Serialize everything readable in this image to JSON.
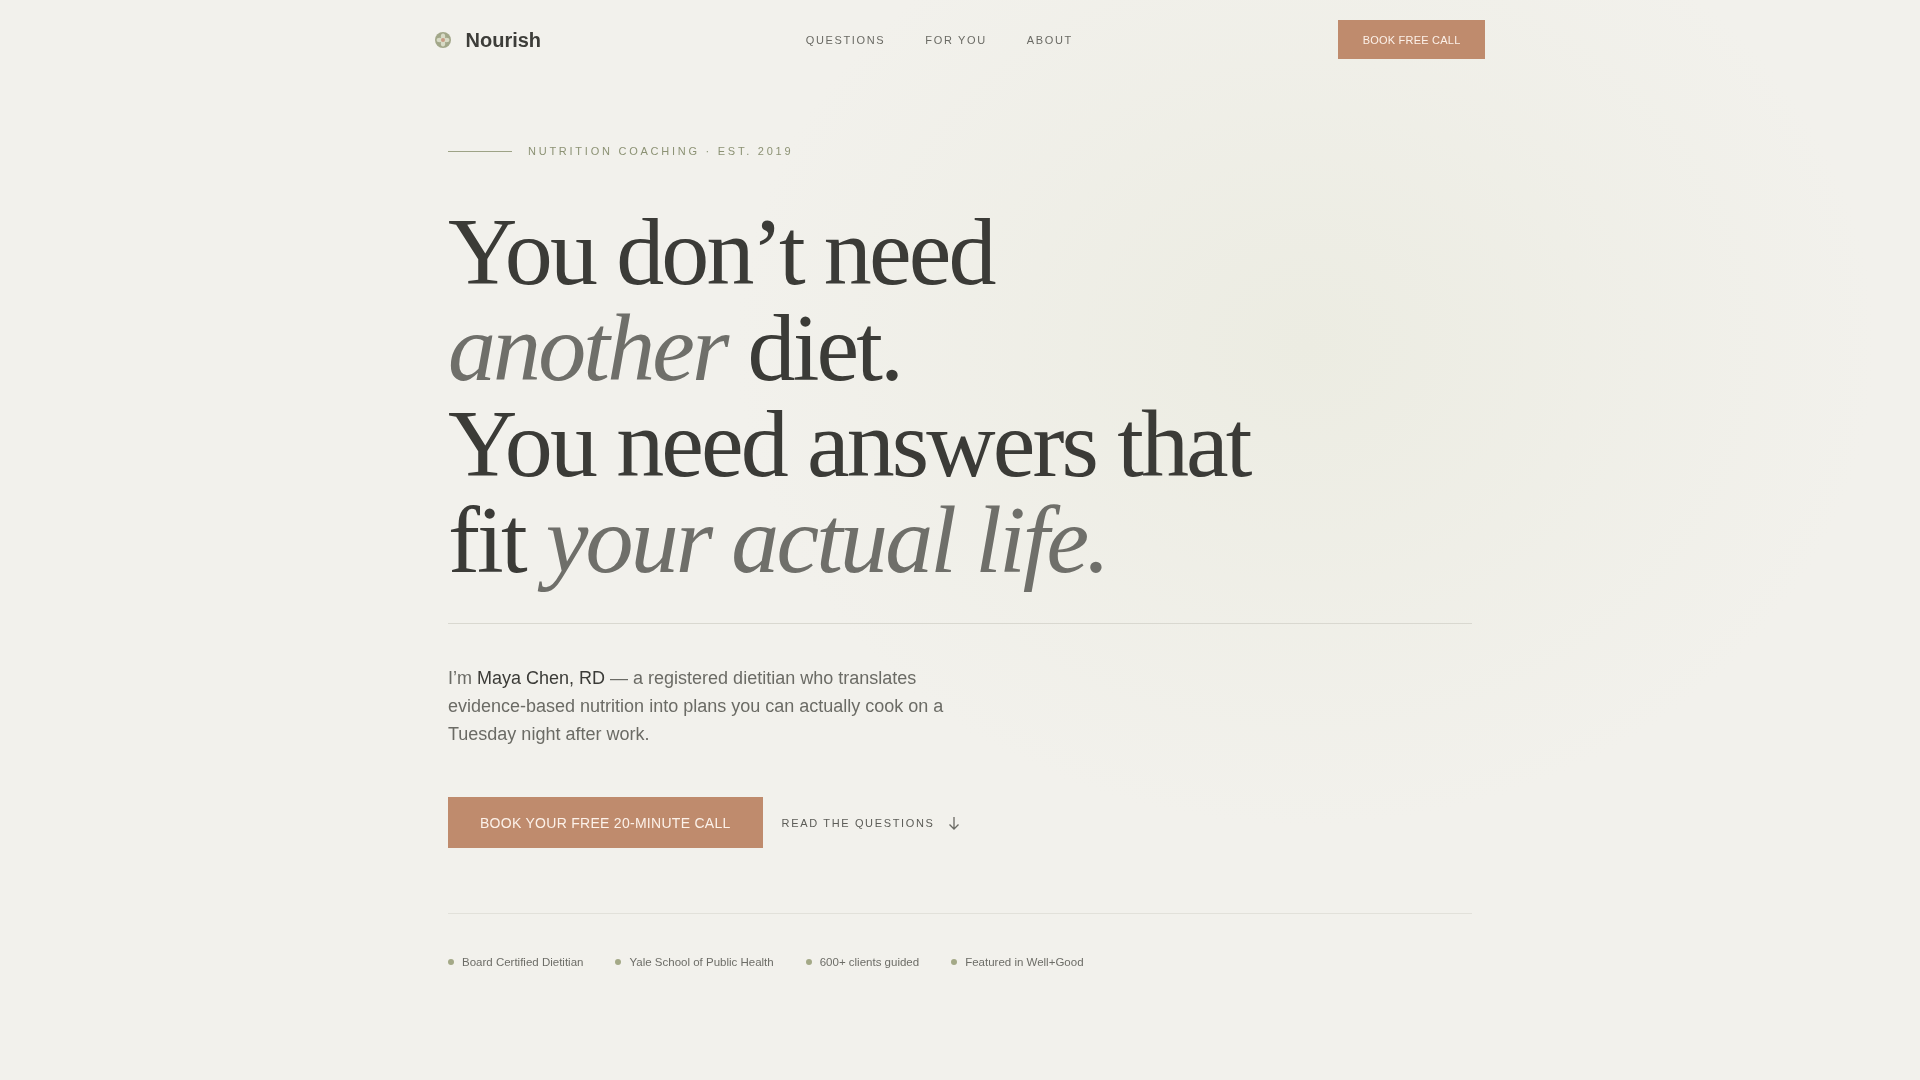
{
  "brand": {
    "name": "Nourish"
  },
  "nav": {
    "links": [
      "QUESTIONS",
      "FOR YOU",
      "ABOUT"
    ],
    "cta": "BOOK FREE CALL"
  },
  "hero": {
    "eyebrow": "NUTRITION COACHING · EST. 2019",
    "headline": "You don’t need *another* diet.\nYou need answers that fit *your actual life.*",
    "intro": "I’m **Maya Chen, RD** — a registered dietitian who translates evidence-based nutrition into plans you can actually cook on a Tuesday night after work.",
    "primary_button": "BOOK YOUR FREE 20-MINUTE CALL",
    "secondary_link": "READ THE QUESTIONS"
  },
  "credentials": [
    "Board Certified Dietitian",
    "Yale School of Public Health",
    "600+ clients guided",
    "Featured in Well+Good"
  ]
}
